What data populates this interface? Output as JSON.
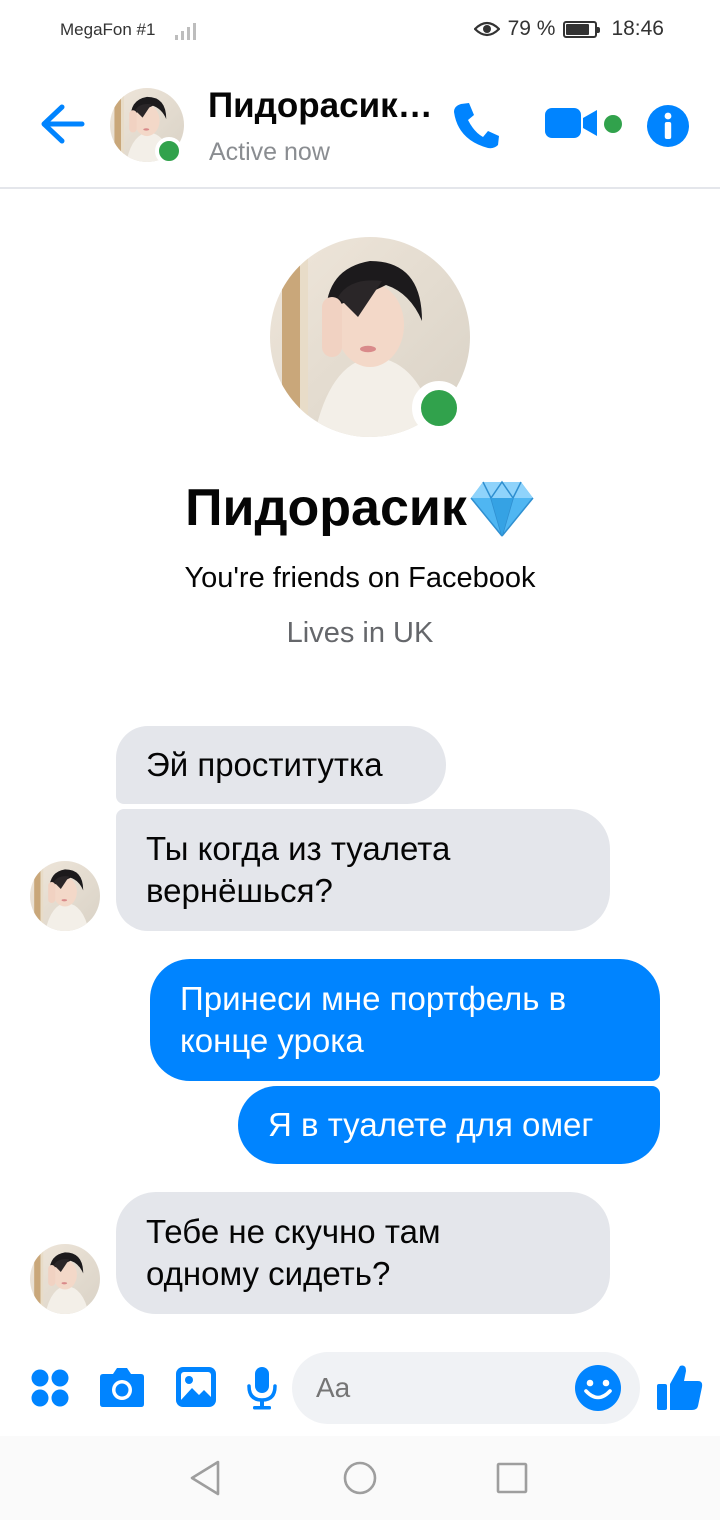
{
  "status_bar": {
    "carrier": "MegaFon #1",
    "battery_percent": "79 %",
    "battery_level": 0.79,
    "time": "18:46"
  },
  "header": {
    "contact_name": "Пидорасик…",
    "status": "Active now"
  },
  "profile": {
    "name": "Пидорасик",
    "friends_text": "You're friends on Facebook",
    "lives_text": "Lives in UK"
  },
  "messages": [
    {
      "direction": "incoming",
      "lines": [
        "Эй проститутка"
      ]
    },
    {
      "direction": "incoming",
      "lines": [
        "Ты когда из туалета",
        "вернёшься?"
      ]
    },
    {
      "direction": "outgoing",
      "lines": [
        "Принеси мне портфель в",
        "конце урока"
      ]
    },
    {
      "direction": "outgoing",
      "lines": [
        "Я в туалете для омег"
      ]
    },
    {
      "direction": "incoming",
      "lines": [
        "Тебе не скучно там",
        "одному сидеть?"
      ]
    }
  ],
  "composer": {
    "placeholder": "Aa"
  },
  "colors": {
    "accent": "#0084ff",
    "online": "#31a24c",
    "incoming_bubble": "#e4e6eb"
  },
  "icons": [
    "back-arrow-icon",
    "phone-icon",
    "video-camera-icon",
    "info-icon",
    "apps-grid-icon",
    "camera-icon",
    "gallery-icon",
    "microphone-icon",
    "smiley-icon",
    "thumbs-up-icon",
    "gem-icon"
  ]
}
